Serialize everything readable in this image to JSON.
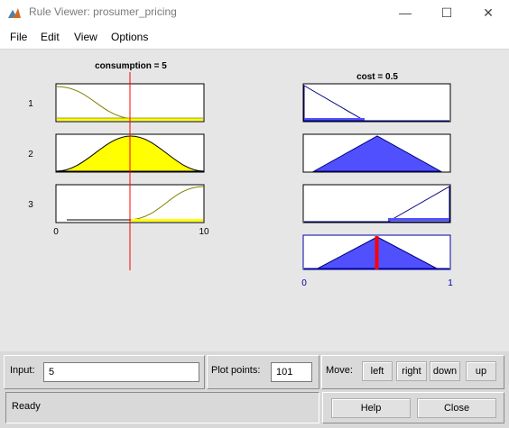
{
  "window": {
    "title": "Rule Viewer: prosumer_pricing",
    "minimize": "—",
    "maximize": "☐",
    "close": "✕"
  },
  "menu": {
    "items": [
      "File",
      "Edit",
      "View",
      "Options"
    ]
  },
  "plots": {
    "input_title": "consumption = 5",
    "output_title": "cost = 0.5",
    "rule_numbers": [
      "1",
      "2",
      "3"
    ],
    "input_axis": {
      "min_label": "0",
      "max_label": "10",
      "value": 5,
      "range": [
        0,
        10
      ]
    },
    "output_axis": {
      "min_label": "0",
      "max_label": "1",
      "value": 0.5,
      "range": [
        0,
        1
      ]
    },
    "colors": {
      "input_fill": "#ffff00",
      "output_fill": "#5050ff",
      "indicator": "#ff0000",
      "mf_line": "#808000"
    }
  },
  "controls": {
    "input_label": "Input:",
    "input_value": "5",
    "plot_points_label": "Plot points:",
    "plot_points_value": "101",
    "move_label": "Move:",
    "move_buttons": [
      "left",
      "right",
      "down",
      "up"
    ],
    "status": "Ready",
    "help_label": "Help",
    "close_label": "Close"
  }
}
